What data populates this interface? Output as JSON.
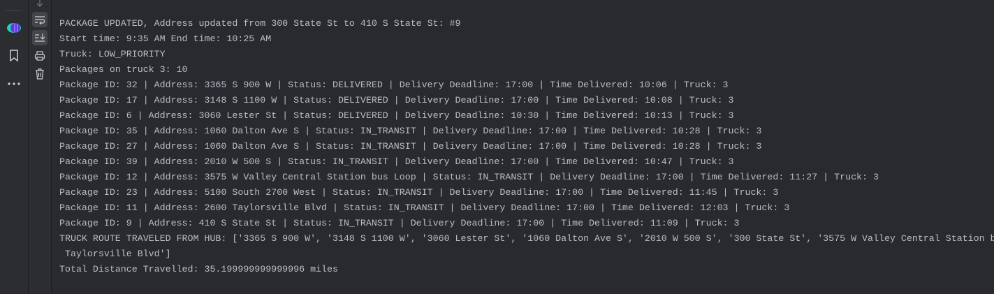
{
  "left_bar": {
    "icons": [
      "plugin-logo-icon",
      "bookmark-icon",
      "more-icon"
    ]
  },
  "toolbar": {
    "icons": [
      "scroll-down-icon",
      "soft-wrap-icon",
      "scroll-to-end-icon",
      "print-icon",
      "trash-icon"
    ]
  },
  "console": {
    "lines": [
      "PACKAGE UPDATED, Address updated from 300 State St to 410 S State St: #9",
      "Start time: 9:35 AM End time: 10:25 AM",
      "Truck: LOW_PRIORITY",
      "Packages on truck 3: 10",
      "Package ID: 32 | Address: 3365 S 900 W | Status: DELIVERED | Delivery Deadline: 17:00 | Time Delivered: 10:06 | Truck: 3",
      "Package ID: 17 | Address: 3148 S 1100 W | Status: DELIVERED | Delivery Deadline: 17:00 | Time Delivered: 10:08 | Truck: 3",
      "Package ID: 6 | Address: 3060 Lester St | Status: DELIVERED | Delivery Deadline: 10:30 | Time Delivered: 10:13 | Truck: 3",
      "Package ID: 35 | Address: 1060 Dalton Ave S | Status: IN_TRANSIT | Delivery Deadline: 17:00 | Time Delivered: 10:28 | Truck: 3",
      "Package ID: 27 | Address: 1060 Dalton Ave S | Status: IN_TRANSIT | Delivery Deadline: 17:00 | Time Delivered: 10:28 | Truck: 3",
      "Package ID: 39 | Address: 2010 W 500 S | Status: IN_TRANSIT | Delivery Deadline: 17:00 | Time Delivered: 10:47 | Truck: 3",
      "Package ID: 12 | Address: 3575 W Valley Central Station bus Loop | Status: IN_TRANSIT | Delivery Deadline: 17:00 | Time Delivered: 11:27 | Truck: 3",
      "Package ID: 23 | Address: 5100 South 2700 West | Status: IN_TRANSIT | Delivery Deadline: 17:00 | Time Delivered: 11:45 | Truck: 3",
      "Package ID: 11 | Address: 2600 Taylorsville Blvd | Status: IN_TRANSIT | Delivery Deadline: 17:00 | Time Delivered: 12:03 | Truck: 3",
      "Package ID: 9 | Address: 410 S State St | Status: IN_TRANSIT | Delivery Deadline: 17:00 | Time Delivered: 11:09 | Truck: 3",
      "TRUCK ROUTE TRAVELED FROM HUB: ['3365 S 900 W', '3148 S 1100 W', '3060 Lester St', '1060 Dalton Ave S', '2010 W 500 S', '300 State St', '3575 W Valley Central Station b",
      " Taylorsville Blvd']",
      "Total Distance Travelled: 35.199999999999996 miles"
    ]
  }
}
